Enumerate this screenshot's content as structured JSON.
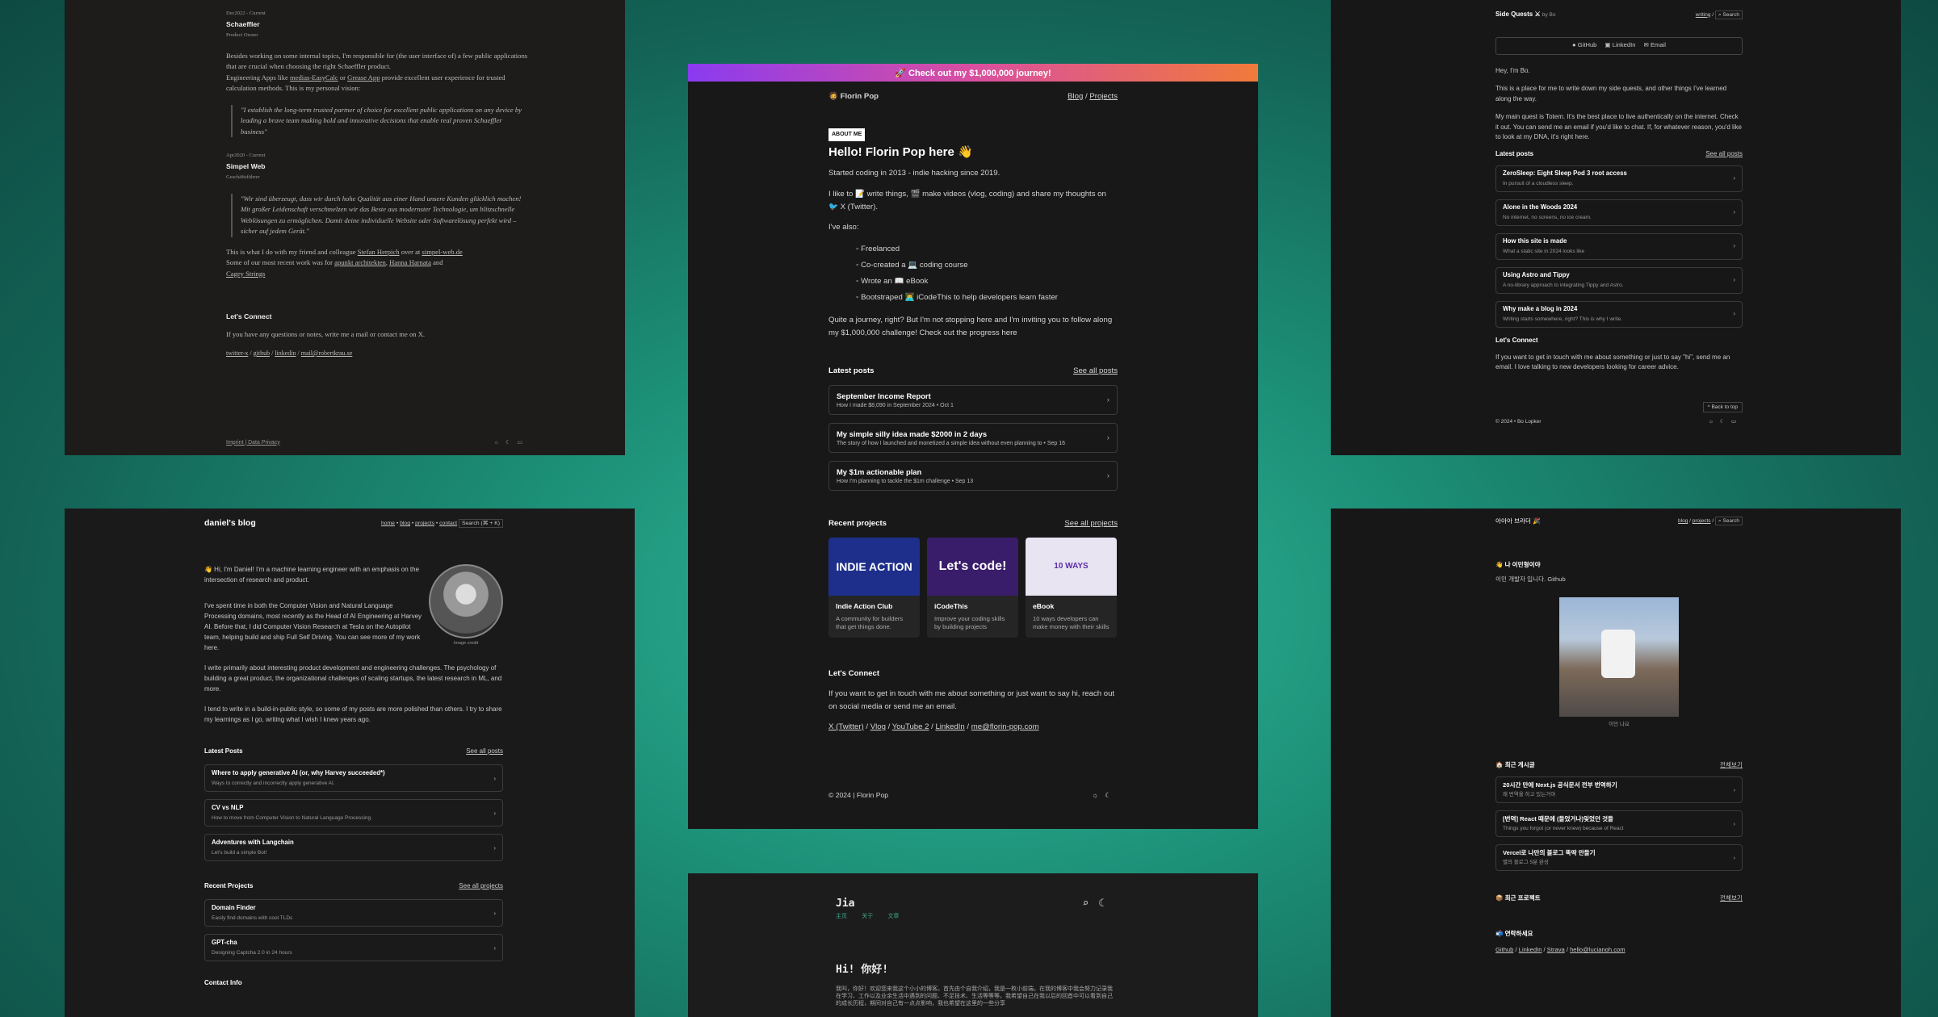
{
  "p1": {
    "date1": "Dec2022 - Current",
    "company1": "Schaeffler",
    "role1": "Product Owner",
    "para1a": "Besides working on some internal topics, I'm responsible for (the user interface of) a few public applications that are crucial when choosing the right Schaeffler product.",
    "para1b_pre": "Engineering Apps like ",
    "link_medias": "medias-EasyCalc",
    "or": " or ",
    "link_grease": "Grease App",
    "para1b_post": " provide excellent user experience for trusted calculation methods. This is my personal vision:",
    "quote1": "\"I establish the long-term trusted partner of choice for excellent public applications on any device by leading a brave team making bold and innovative decisions that enable real proven Schaeffler business\"",
    "date2": "Apr2020 - Current",
    "company2": "Simpel Web",
    "role2": "Geschäftsführer",
    "quote2": "\"Wir sind überzeugt, dass wir durch hohe Qualität aus einer Hand unsere Kunden glücklich machen! Mit großer Leidenschaft verschmelzen wir das Beste aus modernster Technologie, um blitzschnelle Weblösungen zu ermöglichen. Damit deine individuelle Website oder Softwarelösung perfekt wird – sicher auf jedem Gerät.\"",
    "p2a": "This is what I do with my friend and colleague ",
    "link_stefan": "Stefan Herpich",
    "p2b": " over at ",
    "link_simpel": "simpel-web.de",
    "p3": "Some of our most recent work was for ",
    "link_apunkt": "apunkt architekten",
    "link_hanna": "Hanna Harnata",
    "and": " and ",
    "link_cagey": "Cagey Strings",
    "connect": "Let's Connect",
    "connect_text": "If you have any questions or notes, write me a mail or contact me on X.",
    "links": [
      "twitter-x",
      "github",
      "linkedin",
      "mail@robertkrau.se"
    ],
    "footer": "Imprint | Data Privacy"
  },
  "p2": {
    "banner": "🚀 Check out my $1,000,000 journey!",
    "logo": "🧔 Florin Pop",
    "nav": [
      "Blog",
      "Projects"
    ],
    "badge": "ABOUT ME",
    "title": "Hello! Florin Pop here 👋",
    "started": "Started coding in 2013 - indie hacking since 2019.",
    "like": "I like to 📝 write things, 🎬 make videos (vlog, coding) and share my thoughts on 🐦 X (Twitter).",
    "also": "I've also:",
    "bullets": [
      "Freelanced",
      "Co-created a 💻 coding course",
      "Wrote an 📖 eBook",
      "Bootstraped 👨‍💻 iCodeThis to help developers learn faster"
    ],
    "journey": "Quite a journey, right? But I'm not stopping here and I'm inviting you to follow along my $1,000,000 challenge! Check out the progress here",
    "latest": "Latest posts",
    "see_posts": "See all posts",
    "posts": [
      {
        "t": "September Income Report",
        "s": "How I made $8,090 in September 2024 • Oct 1"
      },
      {
        "t": "My simple silly idea made $2000 in 2 days",
        "s": "The story of how I launched and monetized a simple idea without even planning to • Sep 16"
      },
      {
        "t": "My $1m actionable plan",
        "s": "How I'm planning to tackle the $1m challenge • Sep 13"
      }
    ],
    "recent": "Recent projects",
    "see_projects": "See all projects",
    "projects": [
      {
        "img": "INDIE ACTION",
        "t": "Indie Action Club",
        "s": "A community for builders that get things done.",
        "c": "#1d2f8a"
      },
      {
        "img": "Let's code!",
        "t": "iCodeThis",
        "s": "Improve your coding skills by building projects",
        "c": "#3a1d6a"
      },
      {
        "img": "10 WAYS",
        "t": "eBook",
        "s": "10 ways developers can make money with their skills",
        "c": "#e8e4f2"
      }
    ],
    "connect": "Let's Connect",
    "connect_text": "If you want to get in touch with me about something or just want to say hi, reach out on social media or send me an email.",
    "links": [
      "X (Twitter)",
      "Vlog",
      "YouTube 2",
      "LinkedIn",
      "me@florin-pop.com"
    ],
    "footer": "© 2024 | Florin Pop"
  },
  "p3": {
    "title": "Side Quests ⚔",
    "by": "by Bo",
    "nav": [
      "writing",
      "Search"
    ],
    "socials": [
      "GitHub",
      "LinkedIn",
      "Email"
    ],
    "hey": "Hey, I'm Bo.",
    "intro": "This is a place for me to write down my side quests, and other things I've learned along the way.",
    "quest": "My main quest is Totem. It's the best place to live authentically on the internet. Check it out. You can send me an email if you'd like to chat. If, for whatever reason, you'd like to look at my DNA, it's right here.",
    "latest": "Latest posts",
    "see": "See all posts",
    "posts": [
      {
        "t": "ZeroSleep: Eight Sleep Pod 3 root access",
        "s": "In pursuit of a cloudless sleep."
      },
      {
        "t": "Alone in the Woods 2024",
        "s": "No internet, no screens, no ice cream."
      },
      {
        "t": "How this site is made",
        "s": "What a static site in 2024 looks like"
      },
      {
        "t": "Using Astro and Tippy",
        "s": "A no-library approach to integrating Tippy and Astro."
      },
      {
        "t": "Why make a blog in 2024",
        "s": "Writing starts somewhere, right? This is why I write."
      }
    ],
    "connect": "Let's Connect",
    "connect_text": "If you want to get in touch with me about something or just to say \"hi\", send me an email. I love talking to new developers looking for career advice.",
    "top": "Back to top",
    "footer": "© 2024 • Bo Lopker"
  },
  "p4": {
    "title": "daniel's blog",
    "nav": [
      "home",
      "blog",
      "projects",
      "contact"
    ],
    "search": "Search (⌘ + K)",
    "hi": "👋 Hi, I'm Daniel! I'm a machine learning engineer with an emphasis on the intersection of research and product.",
    "spent": "I've spent time in both the Computer Vision and Natural Language Processing domains, most recently as the Head of AI Engineering at Harvey AI. Before that, I did Computer Vision Research at Tesla on the Autopilot team, helping build and ship Full Self Driving. You can see more of my work here.",
    "write": "I write primarily about interesting product development and engineering challenges. The psychology of building a great product, the organizational challenges of scaling startups, the latest research in ML, and more.",
    "tend": "I tend to write in a build-in-public style, so some of my posts are more polished than others. I try to share my learnings as I go, writing what I wish I knew years ago.",
    "image_caption": "Image credit",
    "latest": "Latest Posts",
    "see": "See all posts",
    "posts": [
      {
        "t": "Where to apply generative AI (or, why Harvey succeeded*)",
        "s": "Ways to correctly and incorrectly apply generative AI."
      },
      {
        "t": "CV vs NLP",
        "s": "How to move from Computer Vision to Natural Language Processing."
      },
      {
        "t": "Adventures with Langchain",
        "s": "Let's build a simple Bot!"
      }
    ],
    "recent": "Recent Projects",
    "see_proj": "See all projects",
    "projects": [
      {
        "t": "Domain Finder",
        "s": "Easily find domains with cool TLDs"
      },
      {
        "t": "GPT-cha",
        "s": "Designing Captcha 2.0 in 24 hours"
      }
    ],
    "contact": "Contact Info"
  },
  "p5": {
    "title": "Jia",
    "nav": [
      "主页",
      "关于",
      "文章"
    ],
    "hi": "Hi! 你好!",
    "text": "我叫，你好！欢迎您来我这个小小的博客。首先由个自我介绍，我是一枚小前端，在我的博客中我会努力记录我在学习、工作以及业余生活中遇到的问题、不足技术、生活等等等。我希望自己在我以后的回首中可以看到自己的成长历程，期间对自己有一点点影响，我也希望在这里的一些分享"
  },
  "p6": {
    "title": "아아아 브라더 🎉",
    "nav": [
      "blog",
      "projects",
      "Search"
    ],
    "hello": "👋 나 이민형이야",
    "sub": "이민 개발자 입니다. Github",
    "caption": "이민 나요",
    "latest": "🏠 최근 게시글",
    "see": "전체보기",
    "posts": [
      {
        "t": "20시간 만에 Next.js 공식문서 전부 번역하기",
        "s": "왜 번역을 하고 있는거야"
      },
      {
        "t": "[번역] React 때문에 (들었거나)잊었던 것들",
        "s": "Things you forgot (or never knew) because of React"
      },
      {
        "t": "Vercel로 나만의 블로그 뚝딱 만들기",
        "s": "별의 블로그 5분 완성"
      }
    ],
    "projects": "📦 최근 프로젝트",
    "see2": "전체보기",
    "contact": "📬 연락하세요",
    "links": [
      "Github",
      "LinkedIn",
      "Strava",
      "hello@lucianoh.com"
    ]
  }
}
